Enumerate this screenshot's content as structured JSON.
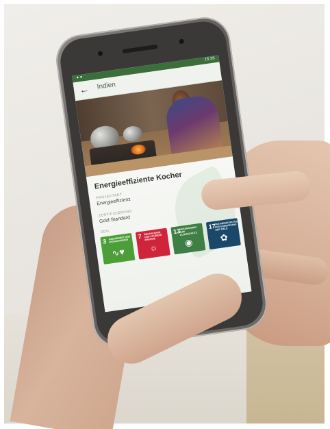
{
  "screen": {
    "status_time": "15:38",
    "status_icons": "● ●",
    "appbar": {
      "back_icon": "arrow-left-icon",
      "title": "Indien"
    },
    "hero_image": "cooking-woman-photo",
    "project": {
      "title": "Energieeffiziente Kocher",
      "type_label": "PROJEKTART",
      "type_value": "Energieeffizienz",
      "cert_label": "ZERTIFIZIERUNG",
      "cert_value": "Gold Standard",
      "goals_label": "SDG"
    },
    "sdg_tiles": [
      {
        "number": "3",
        "text": "GESUNDHEIT UND WOHLERGEHEN",
        "icon": "heartbeat-icon",
        "color": "#4c9f38"
      },
      {
        "number": "7",
        "text": "BEZAHLBARE UND SAUBERE ENERGIE",
        "icon": "sun-power-icon",
        "color": "#d0243a"
      },
      {
        "number": "13",
        "text": "MASSNAHMEN ZUM KLIMASCHUTZ",
        "icon": "eye-globe-icon",
        "color": "#3f7e44"
      },
      {
        "number": "17",
        "text": "PARTNERSCHAFTEN ZUR ERREICHUNG DER ZIELE",
        "icon": "partnership-icon",
        "color": "#19486a"
      }
    ]
  }
}
